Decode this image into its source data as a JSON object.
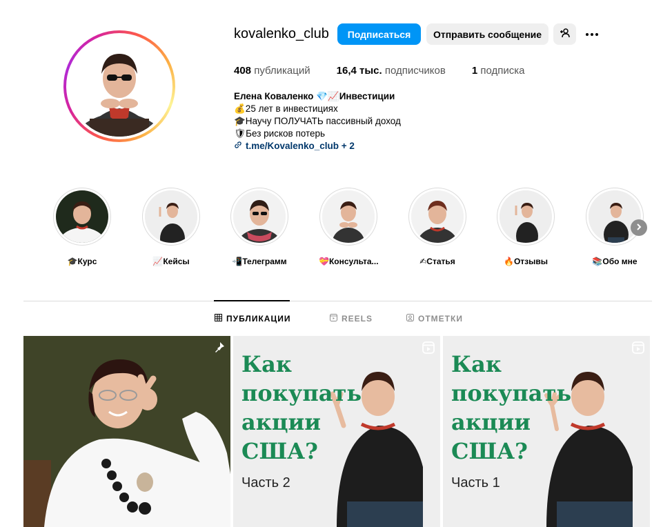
{
  "profile": {
    "username": "kovalenko_club",
    "follow_label": "Подписаться",
    "message_label": "Отправить сообщение",
    "stats": {
      "posts_count": "408",
      "posts_label": "публикаций",
      "followers_count": "16,4 тыс.",
      "followers_label": "подписчиков",
      "following_count": "1",
      "following_label": "подписка"
    },
    "bio": {
      "name": "Елена Коваленко 💎📈Инвестиции",
      "line1": "💰25 лет в инвестициях",
      "line2": "🎓Научу ПОЛУЧАТЬ пассивный доход",
      "line3": "🛡Без рисков потерь",
      "link": "t.me/Kovalenko_club + 2"
    }
  },
  "highlights": [
    {
      "label": "🎓Курс"
    },
    {
      "label": "📈Кейсы"
    },
    {
      "label": "📲Телеграмм"
    },
    {
      "label": "💝Консульта..."
    },
    {
      "label": "✍Статья"
    },
    {
      "label": "🔥Отзывы"
    },
    {
      "label": "📚Обо мне"
    }
  ],
  "tabs": {
    "posts": "ПУБЛИКАЦИИ",
    "reels": "REELS",
    "tagged": "ОТМЕТКИ"
  },
  "posts": [
    {
      "type": "photo",
      "pinned": true
    },
    {
      "type": "reel",
      "title": "Как\nпокупать\nакции\nСША?",
      "subtitle": "Часть 2"
    },
    {
      "type": "reel",
      "title": "Как\nпокупать\nакции\nСША?",
      "subtitle": "Часть 1"
    }
  ],
  "colors": {
    "accent": "#0095f6",
    "link": "#00376b",
    "post_title_green": "#1b8a55",
    "ring_gradient": [
      "#fcb045",
      "#fd1d1d",
      "#d6249f",
      "#833ab4"
    ]
  },
  "icons": {
    "suggest": "add-person-icon",
    "more": "more-dots-icon",
    "link": "link-icon",
    "next": "chevron-right-icon",
    "posts_tab": "grid-icon",
    "reels_tab": "reels-icon",
    "tagged_tab": "tag-icon",
    "pinned": "pin-icon"
  }
}
